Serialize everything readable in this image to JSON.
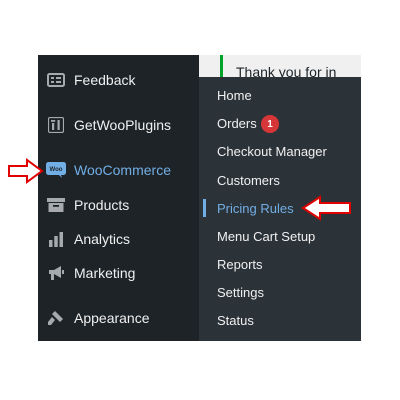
{
  "notice": {
    "text": "Thank you for in"
  },
  "sidebar": {
    "items": [
      {
        "label": "Feedback",
        "icon": "feedback-icon"
      },
      {
        "label": "GetWooPlugins",
        "icon": "getwooplugins-icon"
      },
      {
        "label": "WooCommerce",
        "icon": "woocommerce-icon",
        "current": true
      },
      {
        "label": "Products",
        "icon": "products-icon"
      },
      {
        "label": "Analytics",
        "icon": "analytics-icon"
      },
      {
        "label": "Marketing",
        "icon": "marketing-icon"
      },
      {
        "label": "Appearance",
        "icon": "appearance-icon"
      }
    ],
    "woo_icon_text": "Woo"
  },
  "flyout": {
    "items": [
      {
        "label": "Home"
      },
      {
        "label": "Orders",
        "badge": "1"
      },
      {
        "label": "Checkout Manager"
      },
      {
        "label": "Customers"
      },
      {
        "label": "Pricing Rules",
        "current": true
      },
      {
        "label": "Menu Cart Setup"
      },
      {
        "label": "Reports"
      },
      {
        "label": "Settings"
      },
      {
        "label": "Status"
      }
    ]
  },
  "colors": {
    "sidebar_bg": "#1d2327",
    "flyout_bg": "#2c3338",
    "accent": "#72aee6",
    "text": "#f0f0f1",
    "badge": "#d63638",
    "annotation_arrow": "#e00000",
    "notice_bar": "#00a32a"
  }
}
